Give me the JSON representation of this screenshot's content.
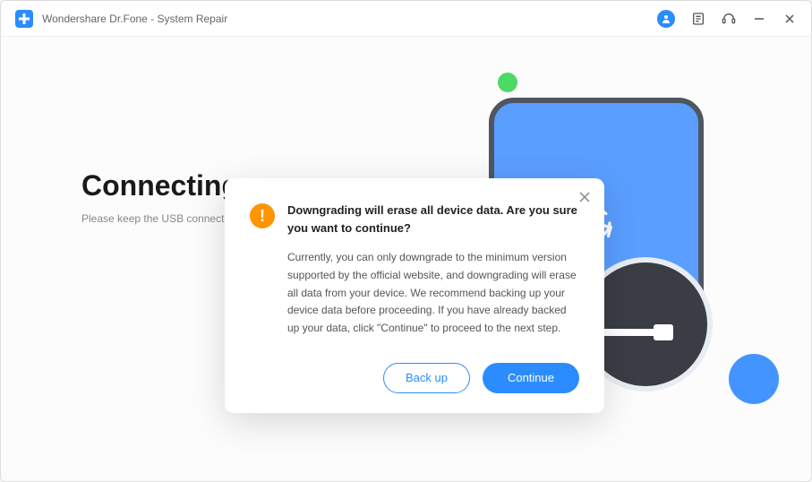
{
  "window": {
    "title": "Wondershare Dr.Fone - System Repair"
  },
  "main": {
    "heading": "Connecting...",
    "subtext": "Please keep the USB connection"
  },
  "modal": {
    "title": "Downgrading will erase all device data. Are you sure you want to continue?",
    "body": "Currently, you can only downgrade to the minimum version supported by the official website, and downgrading will erase all data from your device. We recommend backing up your device data before proceeding. If you have already backed up your data, click \"Continue\" to proceed to the next step.",
    "backup_label": "Back up",
    "continue_label": "Continue"
  }
}
